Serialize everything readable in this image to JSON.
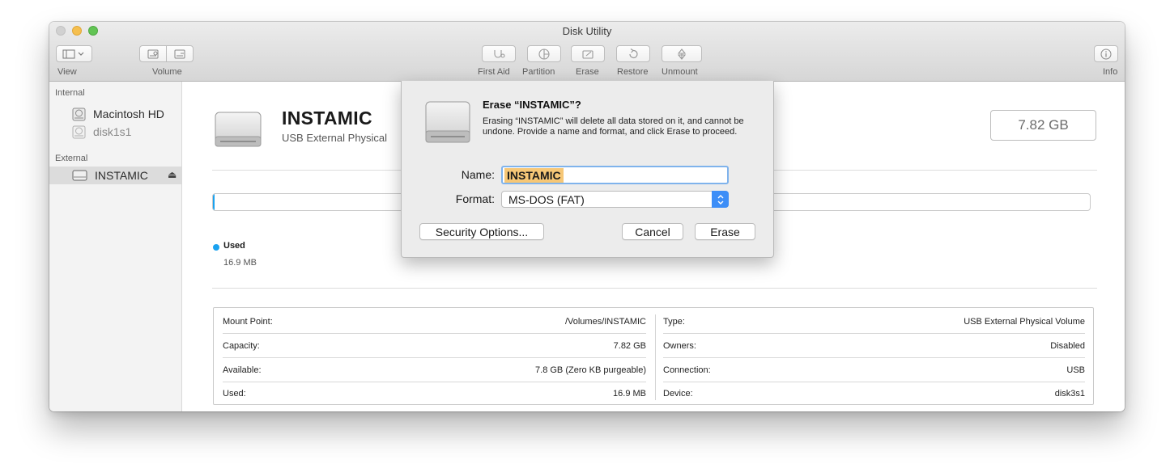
{
  "window": {
    "title": "Disk Utility"
  },
  "toolbar": {
    "view_label": "View",
    "volume_label": "Volume",
    "first_aid_label": "First Aid",
    "partition_label": "Partition",
    "erase_label": "Erase",
    "restore_label": "Restore",
    "unmount_label": "Unmount",
    "info_label": "Info"
  },
  "sidebar": {
    "internal_heading": "Internal",
    "external_heading": "External",
    "items": [
      {
        "label": "Macintosh HD",
        "icon": "internal-disk-icon",
        "state": "normal"
      },
      {
        "label": "disk1s1",
        "icon": "internal-disk-icon",
        "state": "dimmed"
      },
      {
        "label": "INSTAMIC",
        "icon": "external-disk-icon",
        "state": "selected",
        "eject": "⏏"
      }
    ]
  },
  "volume": {
    "name": "INSTAMIC",
    "subtitle": "USB External Physical",
    "capacity": "7.82 GB",
    "used_legend": "Used",
    "used_value": "16.9 MB",
    "used_fraction": 0.0022
  },
  "info_table": {
    "left": [
      {
        "key": "Mount Point:",
        "value": "/Volumes/INSTAMIC"
      },
      {
        "key": "Capacity:",
        "value": "7.82 GB"
      },
      {
        "key": "Available:",
        "value": "7.8 GB (Zero KB purgeable)"
      },
      {
        "key": "Used:",
        "value": "16.9 MB"
      }
    ],
    "right": [
      {
        "key": "Type:",
        "value": "USB External Physical Volume"
      },
      {
        "key": "Owners:",
        "value": "Disabled"
      },
      {
        "key": "Connection:",
        "value": "USB"
      },
      {
        "key": "Device:",
        "value": "disk3s1"
      }
    ]
  },
  "dialog": {
    "title": "Erase “INSTAMIC”?",
    "message": "Erasing “INSTAMIC” will delete all data stored on it, and cannot be undone. Provide a name and format, and click Erase to proceed.",
    "name_label": "Name:",
    "name_value": "INSTAMIC",
    "format_label": "Format:",
    "format_value": "MS-DOS (FAT)",
    "security_button": "Security Options...",
    "cancel_button": "Cancel",
    "erase_button": "Erase"
  },
  "colors": {
    "accent": "#3d8ef7",
    "used_segment": "#1aa2f0",
    "selection_highlight": "#f6c777",
    "sidebar_selected": "#dcdcdc"
  }
}
